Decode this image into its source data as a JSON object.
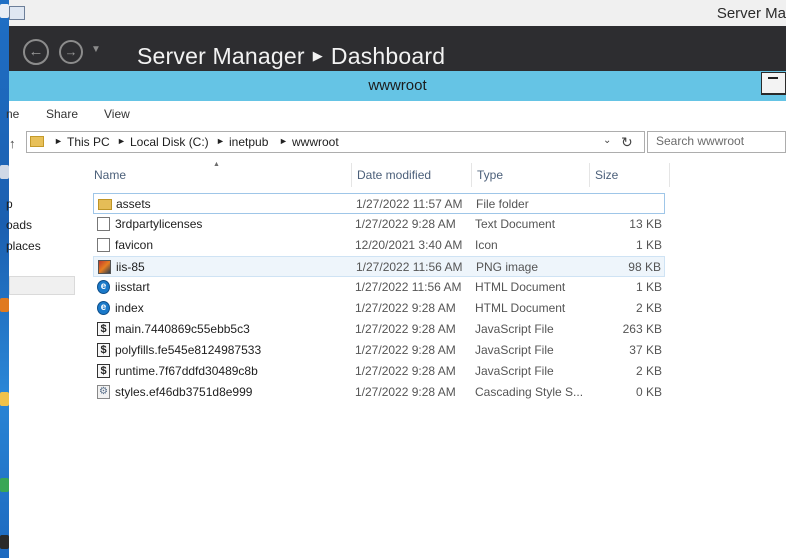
{
  "server_manager": {
    "title": "Server Ma",
    "breadcrumb": [
      "Server Manager",
      "Dashboard"
    ]
  },
  "explorer": {
    "title": "wwwroot",
    "ribbon_tabs": [
      "ne",
      "Share",
      "View"
    ],
    "address": [
      "This PC",
      "Local Disk (C:)",
      "inetpub",
      "wwwroot"
    ],
    "search_placeholder": "Search wwwroot",
    "nav_items": [
      "p",
      "oads",
      "places"
    ],
    "columns": [
      "Name",
      "Date modified",
      "Type",
      "Size"
    ],
    "files": [
      {
        "name": "assets",
        "date": "1/27/2022 11:57 AM",
        "type": "File folder",
        "size": "",
        "icon": "folder-icon"
      },
      {
        "name": "3rdpartylicenses",
        "date": "1/27/2022 9:28 AM",
        "type": "Text Document",
        "size": "13 KB",
        "icon": "text-document-icon"
      },
      {
        "name": "favicon",
        "date": "12/20/2021 3:40 AM",
        "type": "Icon",
        "size": "1 KB",
        "icon": "icon-file-icon"
      },
      {
        "name": "iis-85",
        "date": "1/27/2022 11:56 AM",
        "type": "PNG image",
        "size": "98 KB",
        "icon": "png-image-icon"
      },
      {
        "name": "iisstart",
        "date": "1/27/2022 11:56 AM",
        "type": "HTML Document",
        "size": "1 KB",
        "icon": "html-document-icon"
      },
      {
        "name": "index",
        "date": "1/27/2022 9:28 AM",
        "type": "HTML Document",
        "size": "2 KB",
        "icon": "html-document-icon"
      },
      {
        "name": "main.7440869c55ebb5c3",
        "date": "1/27/2022 9:28 AM",
        "type": "JavaScript File",
        "size": "263 KB",
        "icon": "javascript-file-icon"
      },
      {
        "name": "polyfills.fe545e8124987533",
        "date": "1/27/2022 9:28 AM",
        "type": "JavaScript File",
        "size": "37 KB",
        "icon": "javascript-file-icon"
      },
      {
        "name": "runtime.7f67ddfd30489c8b",
        "date": "1/27/2022 9:28 AM",
        "type": "JavaScript File",
        "size": "2 KB",
        "icon": "javascript-file-icon"
      },
      {
        "name": "styles.ef46db3751d8e999",
        "date": "1/27/2022 9:28 AM",
        "type": "Cascading Style S...",
        "size": "0 KB",
        "icon": "css-file-icon"
      }
    ]
  },
  "colors": {
    "explorer_titlebar": "#65c4e5",
    "server_manager_header": "#2d2d30",
    "selection_border": "#9fc6e8"
  }
}
